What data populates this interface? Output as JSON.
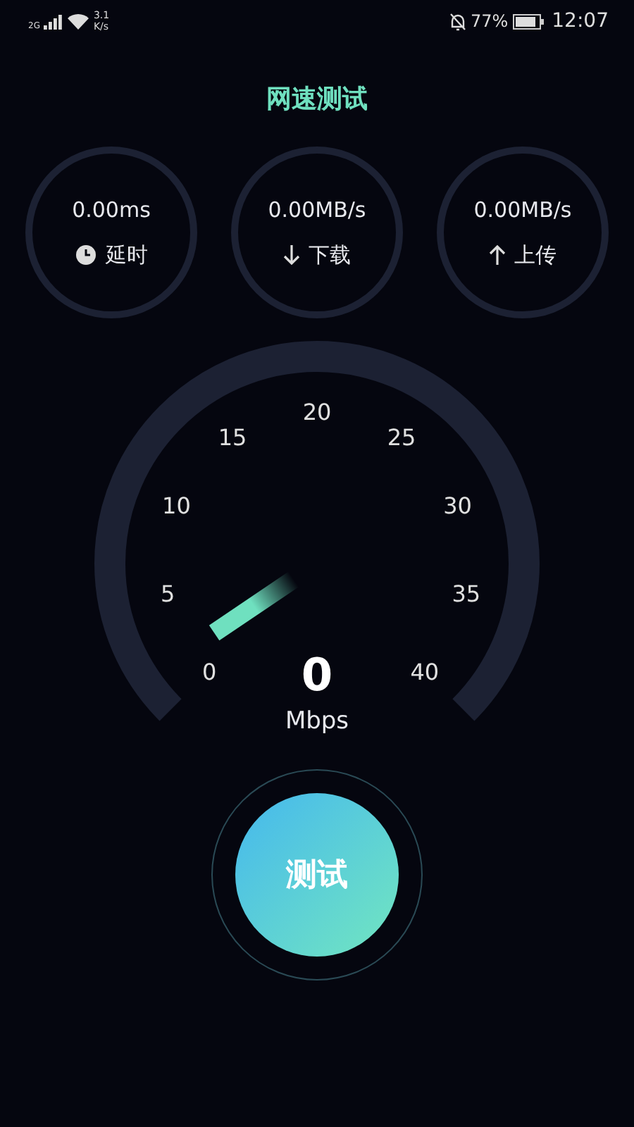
{
  "status_bar": {
    "network": "2G",
    "speed_value": "3.1",
    "speed_unit": "K/s",
    "battery": "77%",
    "time": "12:07"
  },
  "title": "网速测试",
  "stats": [
    {
      "kind": "latency",
      "value": "0.00ms",
      "label": "延时"
    },
    {
      "kind": "download",
      "value": "0.00MB/s",
      "label": "下载"
    },
    {
      "kind": "upload",
      "value": "0.00MB/s",
      "label": "上传"
    }
  ],
  "gauge": {
    "ticks": [
      "0",
      "5",
      "10",
      "15",
      "20",
      "25",
      "30",
      "35",
      "40"
    ],
    "reading": "0",
    "unit": "Mbps"
  },
  "test_button": "测试"
}
